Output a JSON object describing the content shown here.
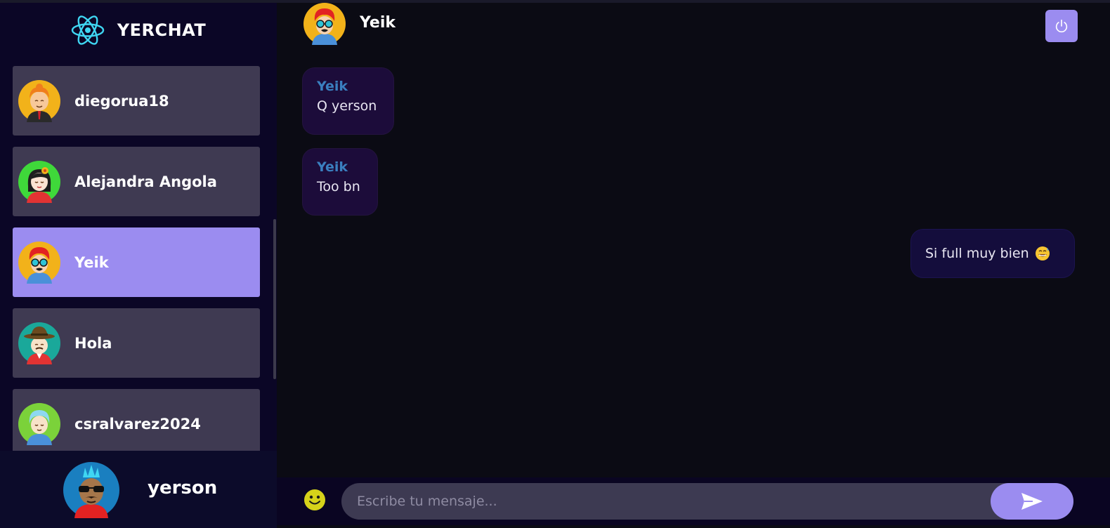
{
  "app": {
    "name": "YERCHAT",
    "logo_icon": "react-atom-icon",
    "accent": "#9b8cf0"
  },
  "contacts": [
    {
      "name": "diegorua18",
      "active": false,
      "avatar": "avatar-orange-hair-icon"
    },
    {
      "name": "Alejandra Angola",
      "active": false,
      "avatar": "avatar-girl-flower-icon"
    },
    {
      "name": "Yeik",
      "active": true,
      "avatar": "avatar-red-hair-glasses-icon"
    },
    {
      "name": "Hola",
      "active": false,
      "avatar": "avatar-hat-man-icon"
    },
    {
      "name": "csralvarez2024",
      "active": false,
      "avatar": "avatar-blue-hair-icon"
    }
  ],
  "current_user": {
    "name": "yerson",
    "avatar": "avatar-mohawk-sunglasses-icon"
  },
  "chat": {
    "contact_name": "Yeik",
    "logout_icon": "power-icon",
    "messages": [
      {
        "sender": "Yeik",
        "text": "Q yerson",
        "direction": "incoming"
      },
      {
        "sender": "Yeik",
        "text": "Too bn",
        "direction": "incoming"
      },
      {
        "sender": "",
        "text": "Si full muy bien",
        "emoji": "grinning-sweat-emoji",
        "direction": "outgoing"
      }
    ]
  },
  "composer": {
    "placeholder": "Escribe tu mensaje...",
    "value": "",
    "emoji_icon": "smiley-icon",
    "send_icon": "send-arrow-icon"
  }
}
